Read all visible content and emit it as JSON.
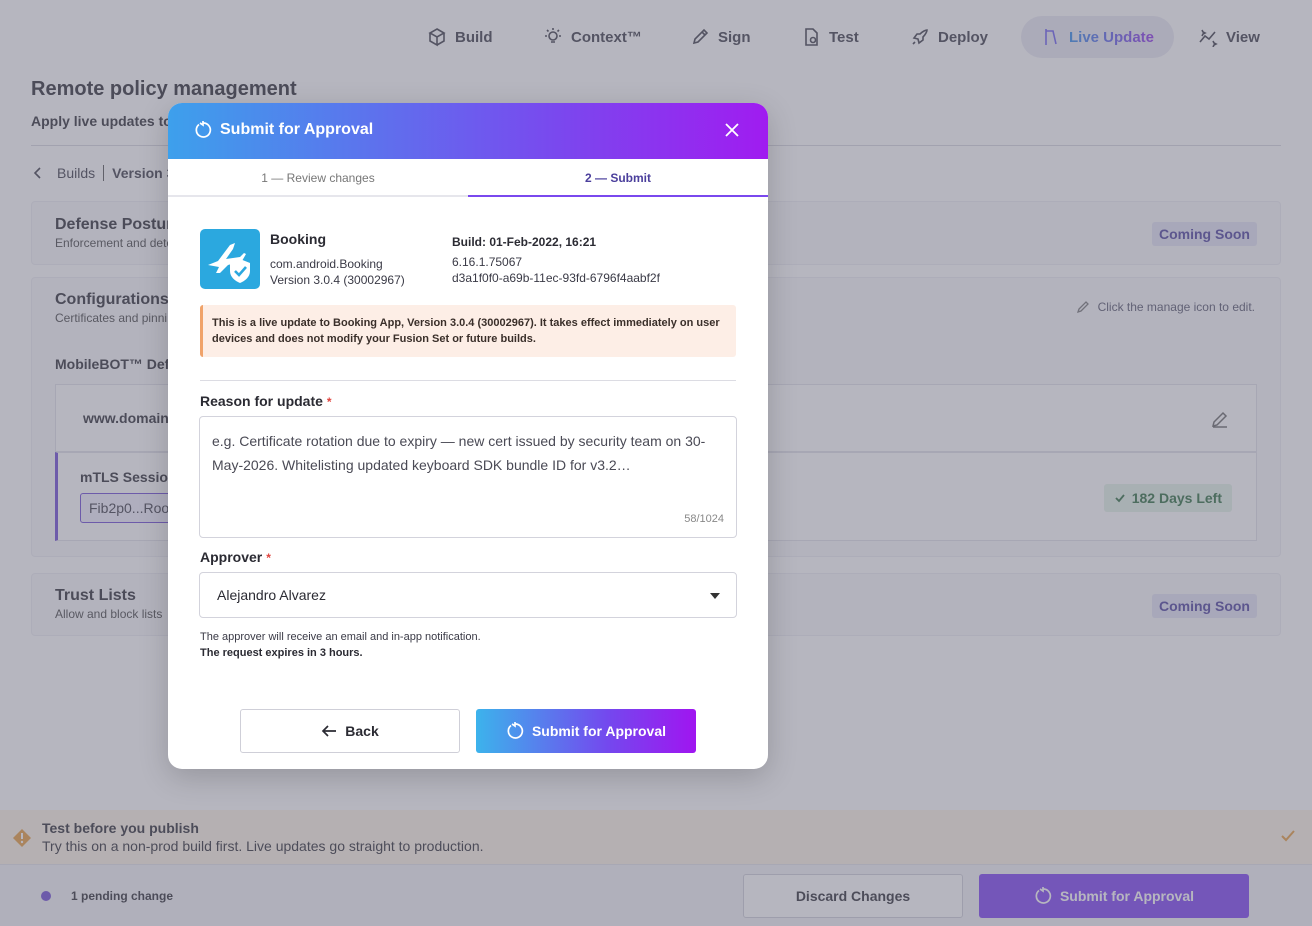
{
  "nav": {
    "build": "Build",
    "context": "Context™",
    "sign": "Sign",
    "test": "Test",
    "deploy": "Deploy",
    "live_update": "Live Update",
    "view": "View"
  },
  "page": {
    "title": "Remote policy management",
    "subtitle": "Apply live updates to d",
    "breadcrumb_builds": "Builds",
    "breadcrumb_version": "Version 3"
  },
  "cards": {
    "defense": {
      "title": "Defense Posture",
      "subtitle": "Enforcement and dete",
      "badge": "Coming Soon"
    },
    "config": {
      "title": "Configurations",
      "subtitle": "Certificates and pinni",
      "hint": "Click the manage icon to edit."
    },
    "mobilebot_label": "MobileBOT™ Defe",
    "domain_text": "www.domain-",
    "mtls_title": "mTLS Session C",
    "mtls_chip": "Fib2p0...Root",
    "days_left": "182 Days Left",
    "trust": {
      "title": "Trust Lists",
      "subtitle": "Allow and block lists",
      "badge": "Coming Soon"
    }
  },
  "banner": {
    "title": "Test before you publish",
    "text": "Try this on a non-prod build first. Live updates go straight to production."
  },
  "footer": {
    "pending": "1 pending change",
    "discard": "Discard Changes",
    "submit": "Submit for Approval"
  },
  "modal": {
    "title": "Submit for Approval",
    "tab1": "1 — Review changes",
    "tab2": "2 — Submit",
    "app": {
      "name": "Booking",
      "package": "com.android.Booking",
      "version": "Version 3.0.4 (30002967)",
      "build_label": "Build: 01-Feb-2022, 16:21",
      "build_number": "6.16.1.75067",
      "build_hash": "d3a1f0f0-a69b-11ec-93fd-6796f4aabf2f"
    },
    "alert": "This is a live update to Booking App, Version 3.0.4 (30002967). It takes effect immediately on user devices and does not modify your Fusion Set or future builds.",
    "reason_label": "Reason for update",
    "reason_placeholder": "e.g. Certificate rotation due to expiry — new cert issued by security team on 30-May-2026. Whitelisting updated keyboard SDK bundle ID for v3.2…",
    "reason_count": "58/1024",
    "approver_label": "Approver",
    "approver_value": "Alejandro Alvarez",
    "note1": "The approver will receive an email and in-app notification.",
    "note2": "The request expires in 3 hours.",
    "back": "Back",
    "submit": "Submit for Approval"
  },
  "colors": {
    "accent": "#7a48ee",
    "gradient_start": "#3da0ec",
    "gradient_end": "#a01cf0",
    "warning": "#f0a36a",
    "success": "#2c6d3f"
  }
}
